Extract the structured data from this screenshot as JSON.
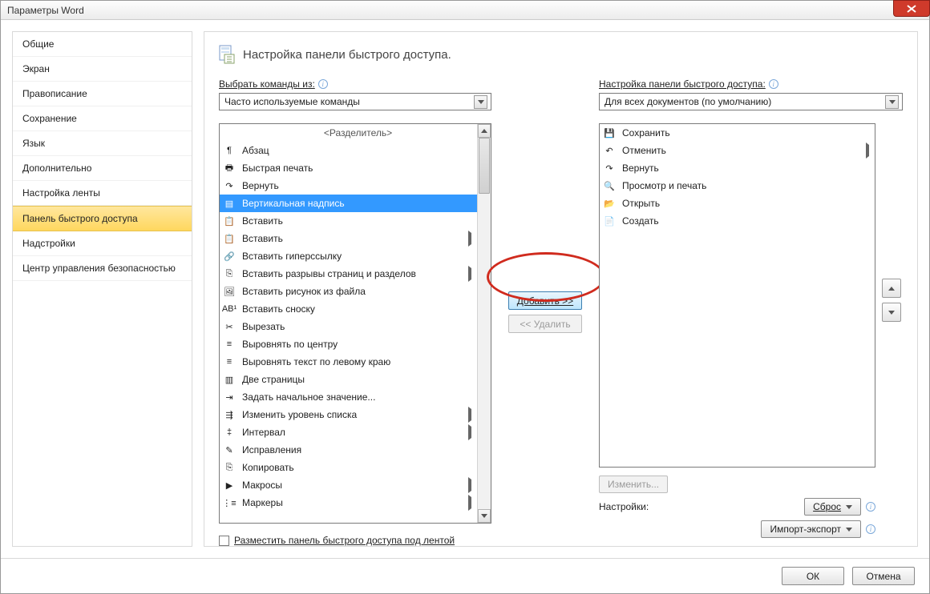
{
  "window": {
    "title": "Параметры Word"
  },
  "sidebar": {
    "items": [
      "Общие",
      "Экран",
      "Правописание",
      "Сохранение",
      "Язык",
      "Дополнительно",
      "Настройка ленты",
      "Панель быстрого доступа",
      "Надстройки",
      "Центр управления безопасностью"
    ],
    "selected_index": 7
  },
  "header": {
    "title": "Настройка панели быстрого доступа."
  },
  "left": {
    "label": "Выбрать команды из:",
    "dropdown": "Часто используемые команды",
    "items": [
      {
        "icon": "",
        "label": "<Разделитель>",
        "sep": true
      },
      {
        "icon": "¶",
        "label": "Абзац"
      },
      {
        "icon": "🖶",
        "label": "Быстрая печать"
      },
      {
        "icon": "↷",
        "label": "Вернуть"
      },
      {
        "icon": "▤",
        "label": "Вертикальная надпись",
        "selected": true
      },
      {
        "icon": "📋",
        "label": "Вставить"
      },
      {
        "icon": "📋",
        "label": "Вставить",
        "submenu": true
      },
      {
        "icon": "🔗",
        "label": "Вставить гиперссылку"
      },
      {
        "icon": "⎘",
        "label": "Вставить разрывы страниц и разделов",
        "submenu": true
      },
      {
        "icon": "🖼",
        "label": "Вставить рисунок из файла"
      },
      {
        "icon": "AB¹",
        "label": "Вставить сноску"
      },
      {
        "icon": "✂",
        "label": "Вырезать"
      },
      {
        "icon": "≡",
        "label": "Выровнять по центру"
      },
      {
        "icon": "≡",
        "label": "Выровнять текст по левому краю"
      },
      {
        "icon": "▥",
        "label": "Две страницы"
      },
      {
        "icon": "⇥",
        "label": "Задать начальное значение..."
      },
      {
        "icon": "⇶",
        "label": "Изменить уровень списка",
        "submenu": true
      },
      {
        "icon": "‡",
        "label": "Интервал",
        "submenu": true
      },
      {
        "icon": "✎",
        "label": "Исправления"
      },
      {
        "icon": "⎘",
        "label": "Копировать"
      },
      {
        "icon": "▶",
        "label": "Макросы",
        "submenu": true
      },
      {
        "icon": "⋮≡",
        "label": "Маркеры",
        "submenu": true
      }
    ]
  },
  "right": {
    "label": "Настройка панели быстрого доступа:",
    "dropdown": "Для всех документов (по умолчанию)",
    "items": [
      {
        "icon": "💾",
        "label": "Сохранить"
      },
      {
        "icon": "↶",
        "label": "Отменить",
        "submenu": true
      },
      {
        "icon": "↷",
        "label": "Вернуть"
      },
      {
        "icon": "🔍",
        "label": "Просмотр и печать"
      },
      {
        "icon": "📂",
        "label": "Открыть"
      },
      {
        "icon": "📄",
        "label": "Создать"
      }
    ],
    "modify_btn": "Изменить...",
    "settings_label": "Настройки:",
    "reset_btn": "Сброс",
    "import_btn": "Импорт-экспорт"
  },
  "mid": {
    "add": "Добавить >>",
    "remove": "<< Удалить"
  },
  "below_left": {
    "checkbox_label": "Разместить панель быстрого доступа под лентой"
  },
  "footer": {
    "ok": "ОК",
    "cancel": "Отмена"
  }
}
